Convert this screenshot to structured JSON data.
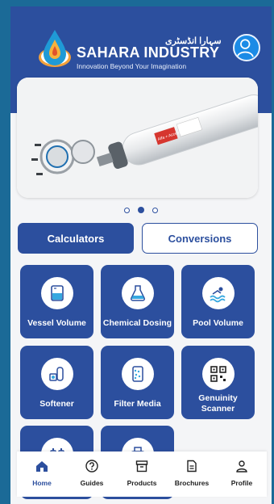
{
  "header": {
    "brand_urdu": "سہارا انڈسٹری",
    "brand_name": "SAHARA INDUSTRY",
    "tagline": "Innovation Beyond Your Imagination"
  },
  "carousel": {
    "slide_count": 3,
    "active_index": 1,
    "product_label": "Alfa + Accessori"
  },
  "tabs": {
    "calculators": "Calculators",
    "conversions": "Conversions"
  },
  "tiles": [
    {
      "label": "Vessel Volume",
      "icon": "vessel-icon"
    },
    {
      "label": "Chemical Dosing",
      "icon": "chemical-dosing-icon"
    },
    {
      "label": "Pool Volume",
      "icon": "pool-icon"
    },
    {
      "label": "Softener",
      "icon": "softener-icon"
    },
    {
      "label": "Filter Media",
      "icon": "filter-media-icon"
    },
    {
      "label": "Genuinity Scanner",
      "icon": "qr-scanner-icon"
    }
  ],
  "nav": [
    {
      "label": "Home",
      "icon": "home-icon",
      "active": true
    },
    {
      "label": "Guides",
      "icon": "help-icon",
      "active": false
    },
    {
      "label": "Products",
      "icon": "products-icon",
      "active": false
    },
    {
      "label": "Brochures",
      "icon": "document-icon",
      "active": false
    },
    {
      "label": "Profile",
      "icon": "person-icon",
      "active": false
    }
  ],
  "colors": {
    "primary": "#2c4f9e",
    "background": "#1b6a97",
    "surface": "#f4f5f7"
  }
}
